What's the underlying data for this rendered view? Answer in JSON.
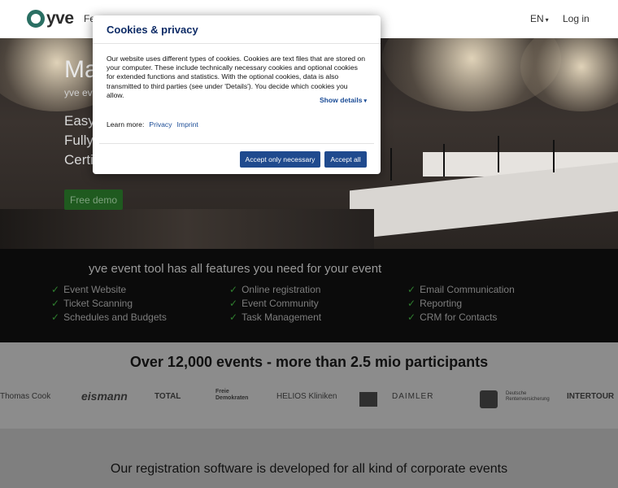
{
  "header": {
    "logo_text": "yve",
    "nav_partial": "Fe",
    "language": "EN",
    "login": "Log in"
  },
  "hero": {
    "title_partial": "Ma",
    "subtitle_partial": "yve ev",
    "lines": [
      "Easy",
      "Fully",
      "Certi"
    ],
    "demo_button": "Free demo"
  },
  "features": {
    "title": "yve event tool has all features you need for your event",
    "columns": [
      [
        "Event Website",
        "Ticket Scanning",
        "Schedules and Budgets"
      ],
      [
        "Online registration",
        "Event Community",
        "Task Management"
      ],
      [
        "Email Communication",
        "Reporting",
        "CRM for Contacts"
      ]
    ]
  },
  "stats": {
    "title": "Over 12,000 events - more than 2.5 mio participants",
    "clients": [
      "Thomas Cook",
      "eismann",
      "TOTAL",
      "Freie Demokraten",
      "HELIOS Kliniken",
      "DAIMLER",
      "Deutsche Rentenversicherung",
      "INTERTOUR"
    ]
  },
  "bottom": {
    "title": "Our registration software is developed for all kind of corporate events"
  },
  "modal": {
    "title": "Cookies & privacy",
    "body": "Our website uses different types of cookies. Cookies are text files that are stored on your computer. These include technically necessary cookies and optional cookies for extended functions and statistics. With the optional cookies, data is also transmitted to third parties (see under 'Details'). You decide which cookies you allow.",
    "show_details": "Show details",
    "learn_more": "Learn more:",
    "privacy_link": "Privacy",
    "imprint_link": "Imprint",
    "btn_necessary": "Accept only necessary",
    "btn_all": "Accept all"
  },
  "colors": {
    "accent": "#1f4a8e",
    "title_blue": "#0d2b66",
    "check_green": "#2f7f2f"
  }
}
